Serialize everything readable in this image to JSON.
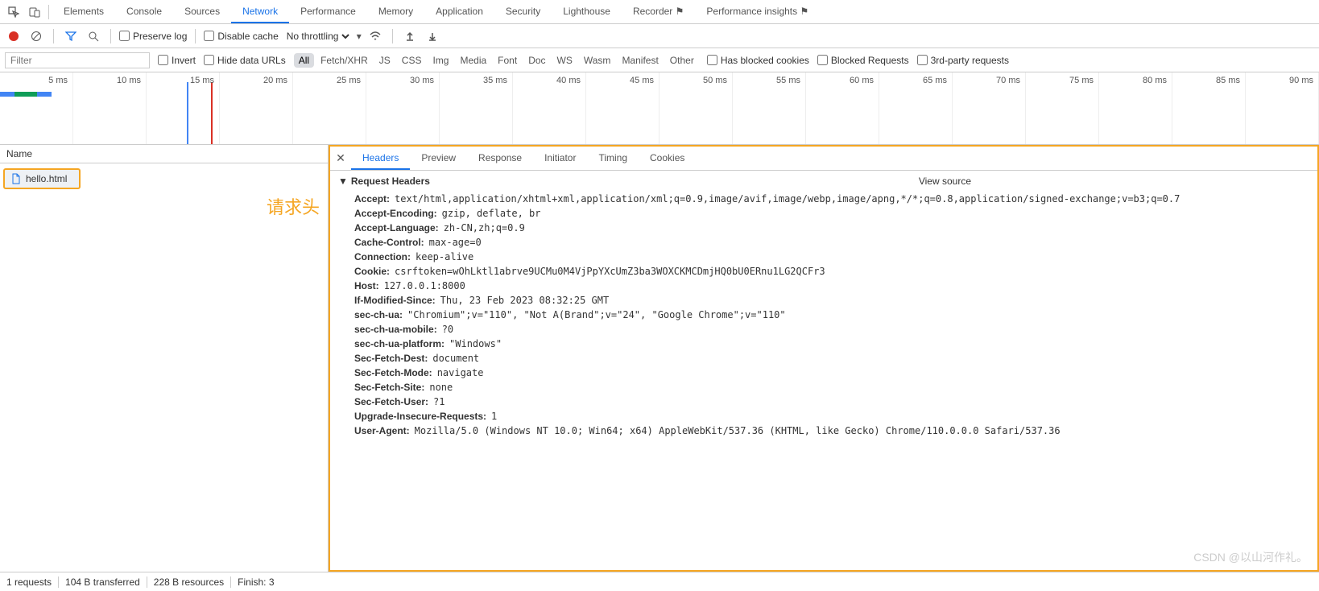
{
  "mainTabs": [
    "Elements",
    "Console",
    "Sources",
    "Network",
    "Performance",
    "Memory",
    "Application",
    "Security",
    "Lighthouse",
    "Recorder ⚑",
    "Performance insights ⚑"
  ],
  "mainActive": 3,
  "toolRow": {
    "preserveLog": "Preserve log",
    "disableCache": "Disable cache",
    "throttling": "No throttling"
  },
  "filter": {
    "placeholder": "Filter",
    "invert": "Invert",
    "hideData": "Hide data URLs",
    "chips": [
      "All",
      "Fetch/XHR",
      "JS",
      "CSS",
      "Img",
      "Media",
      "Font",
      "Doc",
      "WS",
      "Wasm",
      "Manifest",
      "Other"
    ],
    "chipActive": 0,
    "hasBlocked": "Has blocked cookies",
    "blockedReq": "Blocked Requests",
    "thirdParty": "3rd-party requests"
  },
  "timeline": [
    "5 ms",
    "10 ms",
    "15 ms",
    "20 ms",
    "25 ms",
    "30 ms",
    "35 ms",
    "40 ms",
    "45 ms",
    "50 ms",
    "55 ms",
    "60 ms",
    "65 ms",
    "70 ms",
    "75 ms",
    "80 ms",
    "85 ms",
    "90 ms"
  ],
  "leftPane": {
    "header": "Name",
    "file": "hello.html"
  },
  "annotation": "请求头",
  "detailTabs": [
    "Headers",
    "Preview",
    "Response",
    "Initiator",
    "Timing",
    "Cookies"
  ],
  "detailActive": 0,
  "section": {
    "title": "Request Headers",
    "viewSource": "View source"
  },
  "headers": [
    {
      "k": "Accept",
      "v": "text/html,application/xhtml+xml,application/xml;q=0.9,image/avif,image/webp,image/apng,*/*;q=0.8,application/signed-exchange;v=b3;q=0.7"
    },
    {
      "k": "Accept-Encoding",
      "v": "gzip, deflate, br"
    },
    {
      "k": "Accept-Language",
      "v": "zh-CN,zh;q=0.9"
    },
    {
      "k": "Cache-Control",
      "v": "max-age=0"
    },
    {
      "k": "Connection",
      "v": "keep-alive"
    },
    {
      "k": "Cookie",
      "v": "csrftoken=wOhLktl1abrve9UCMu0M4VjPpYXcUmZ3ba3WOXCKMCDmjHQ0bU0ERnu1LG2QCFr3"
    },
    {
      "k": "Host",
      "v": "127.0.0.1:8000"
    },
    {
      "k": "If-Modified-Since",
      "v": "Thu, 23 Feb 2023 08:32:25 GMT"
    },
    {
      "k": "sec-ch-ua",
      "v": "\"Chromium\";v=\"110\", \"Not A(Brand\";v=\"24\", \"Google Chrome\";v=\"110\""
    },
    {
      "k": "sec-ch-ua-mobile",
      "v": "?0"
    },
    {
      "k": "sec-ch-ua-platform",
      "v": "\"Windows\""
    },
    {
      "k": "Sec-Fetch-Dest",
      "v": "document"
    },
    {
      "k": "Sec-Fetch-Mode",
      "v": "navigate"
    },
    {
      "k": "Sec-Fetch-Site",
      "v": "none"
    },
    {
      "k": "Sec-Fetch-User",
      "v": "?1"
    },
    {
      "k": "Upgrade-Insecure-Requests",
      "v": "1"
    },
    {
      "k": "User-Agent",
      "v": "Mozilla/5.0 (Windows NT 10.0; Win64; x64) AppleWebKit/537.36 (KHTML, like Gecko) Chrome/110.0.0.0 Safari/537.36"
    }
  ],
  "status": [
    "1 requests",
    "104 B transferred",
    "228 B resources",
    "Finish: 3"
  ],
  "watermark": "CSDN @以山河作礼。"
}
